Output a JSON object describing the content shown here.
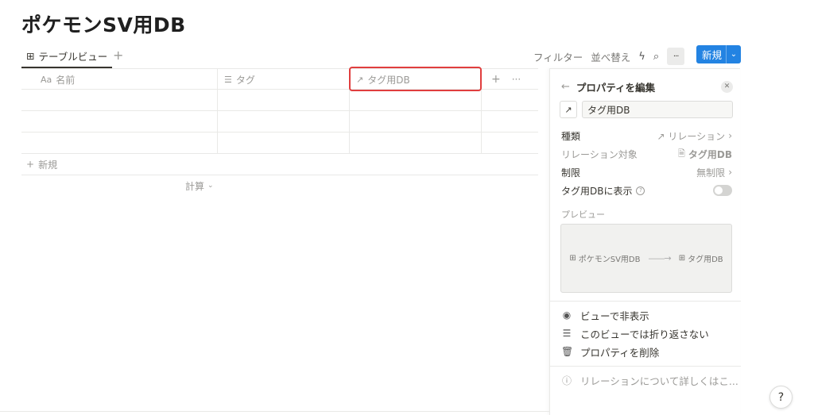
{
  "page": {
    "title": "ポケモンSV用DB"
  },
  "viewbar": {
    "tab_label": "テーブルビュー",
    "add_view": "+",
    "filter": "フィルター",
    "sort": "並べ替え",
    "more": "···",
    "new_label": "新規",
    "new_chevron": "⌄"
  },
  "table": {
    "columns": [
      {
        "icon": "Aa",
        "label": "名前"
      },
      {
        "icon": "☰",
        "label": "タグ"
      },
      {
        "icon": "↗",
        "label": "タグ用DB"
      }
    ],
    "add_column": "+",
    "column_more": "···",
    "new_row": "新規",
    "calculate": "計算"
  },
  "panel": {
    "title": "プロパティを編集",
    "back": "←",
    "close": "✕",
    "name_icon": "↗",
    "name_value": "タグ用DB",
    "type_label": "種類",
    "type_value": "↗ リレーション",
    "relation_target_label": "リレーション対象",
    "relation_target_value": "タグ用DB",
    "limit_label": "制限",
    "limit_value": "無制限",
    "show_on_label": "タグ用DBに表示",
    "show_on_enabled": false,
    "preview_label": "プレビュー",
    "preview_from": "ポケモンSV用DB",
    "preview_to": "タグ用DB",
    "hide_in_view": "ビューで非表示",
    "no_wrap": "このビューでは折り返さない",
    "delete_property": "プロパティを削除",
    "learn_more": "リレーションについて詳しくはこ..."
  },
  "help": "?"
}
